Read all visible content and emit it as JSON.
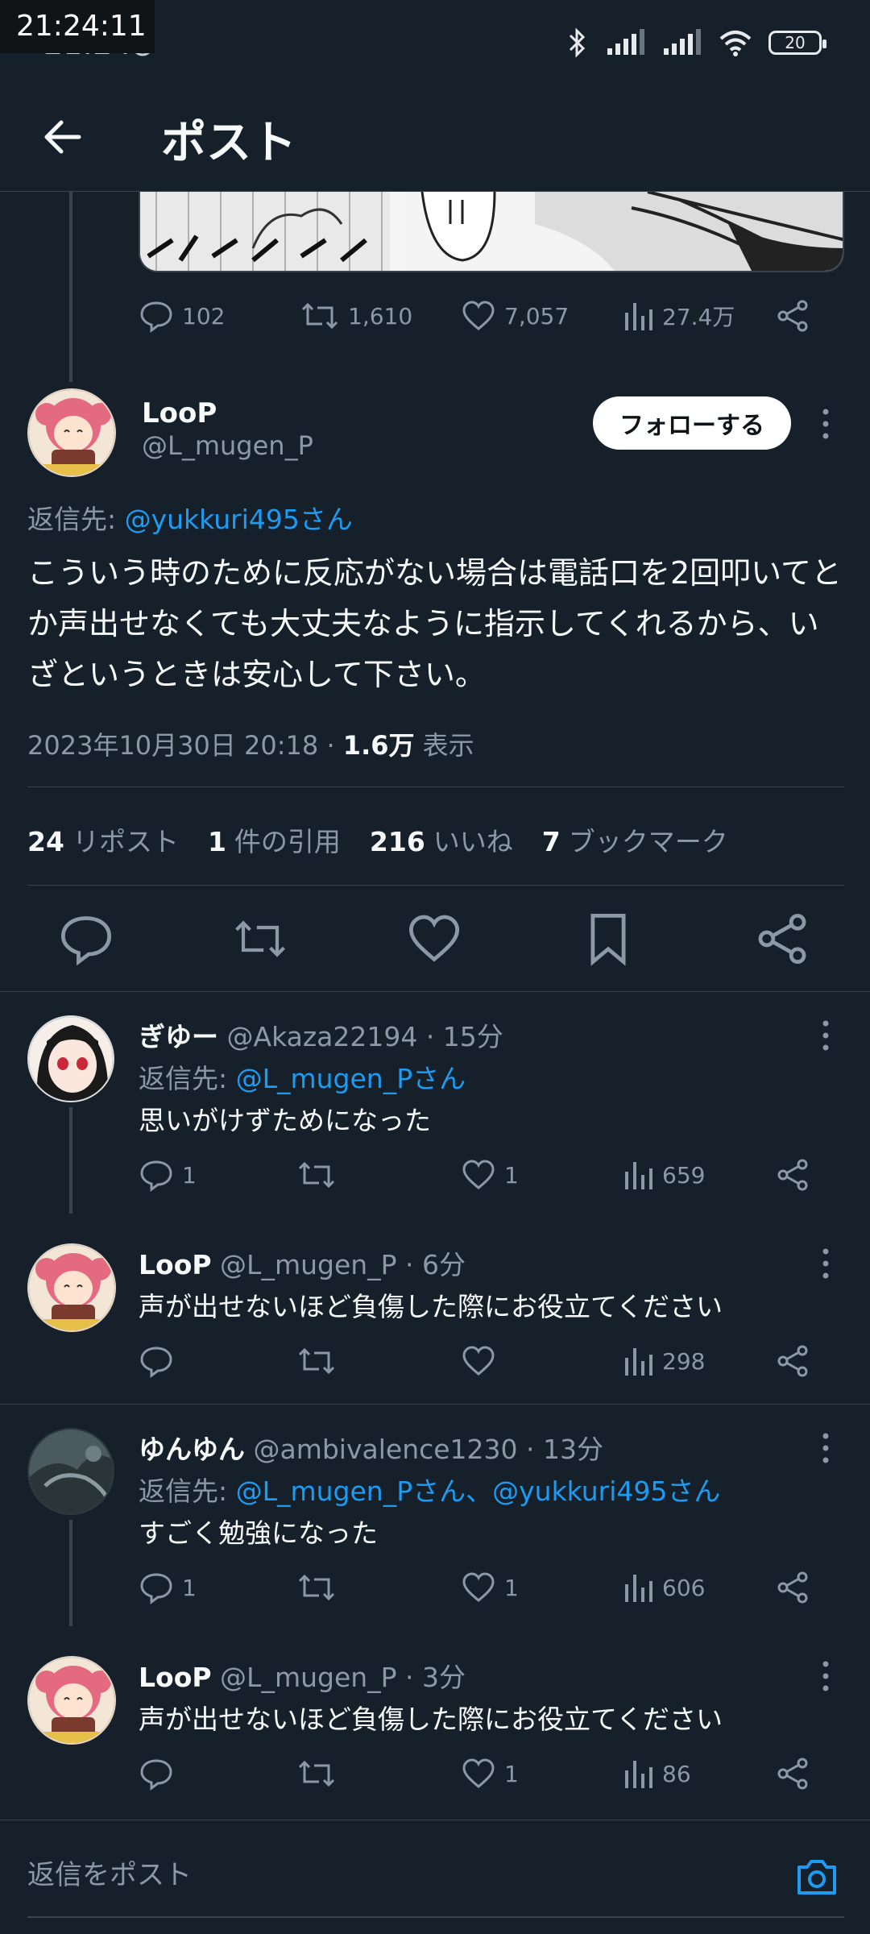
{
  "status_bar": {
    "overlay_time": "21:24:11",
    "time": "21:24",
    "battery": "20"
  },
  "header": {
    "title": "ポスト"
  },
  "previous_post": {
    "replies": "102",
    "reposts": "1,610",
    "likes": "7,057",
    "views": "27.4万"
  },
  "main_post": {
    "name": "LooP",
    "handle": "@L_mugen_P",
    "follow_label": "フォローする",
    "replying_label": "返信先: ",
    "replying_to": "@yukkuri495さん",
    "text": "こういう時のために反応がない場合は電話口を2回叩いてとか声出せなくても大丈夫なように指示してくれるから、いざというときは安心して下さい。",
    "timestamp": "2023年10月30日 20:18 · ",
    "views_count": "1.6万",
    "views_label": " 表示",
    "stats": {
      "reposts_count": "24",
      "reposts_label": "リポスト",
      "quotes_count": "1",
      "quotes_label": "件の引用",
      "likes_count": "216",
      "likes_label": "いいね",
      "bookmarks_count": "7",
      "bookmarks_label": "ブックマーク"
    }
  },
  "replies": [
    {
      "name": "ぎゆー",
      "handle": " @Akaza22194 · 15分",
      "replying_label": "返信先: ",
      "replying_to": "@L_mugen_Pさん",
      "text": "思いがけずためになった",
      "replies": "1",
      "reposts": "",
      "likes": "1",
      "views": "659"
    },
    {
      "name": "LooP",
      "handle": " @L_mugen_P · 6分",
      "text": "声が出せないほど負傷した際にお役立てください",
      "replies": "",
      "reposts": "",
      "likes": "",
      "views": "298"
    },
    {
      "name": "ゆんゆん",
      "handle": " @ambivalence1230 · 13分",
      "replying_label": "返信先: ",
      "replying_to": "@L_mugen_Pさん、@yukkuri495さん",
      "text": "すごく勉強になった",
      "replies": "1",
      "reposts": "",
      "likes": "1",
      "views": "606"
    },
    {
      "name": "LooP",
      "handle": " @L_mugen_P · 3分",
      "text": "声が出せないほど負傷した際にお役立てください",
      "replies": "",
      "reposts": "",
      "likes": "1",
      "views": "86"
    }
  ],
  "composer": {
    "placeholder": "返信をポスト"
  },
  "colors": {
    "background": "#15202b",
    "link": "#1d9bf0",
    "muted": "#8b98a5"
  }
}
